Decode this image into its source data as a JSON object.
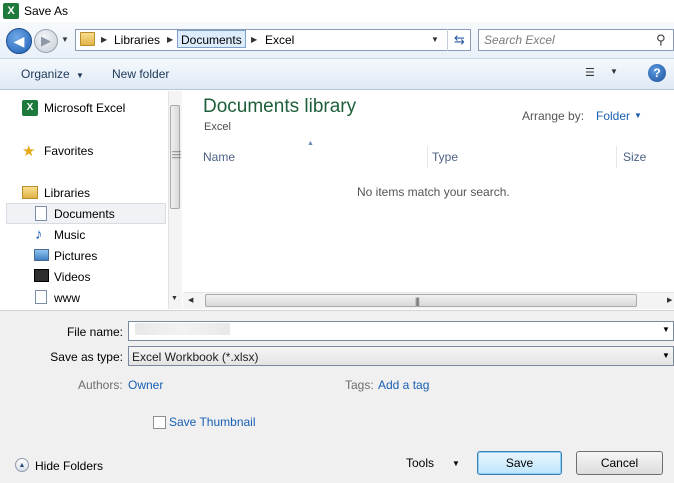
{
  "window": {
    "title": "Save As",
    "app_icon": "excel-icon"
  },
  "address": {
    "breadcrumbs": [
      "Libraries",
      "Documents",
      "Excel"
    ],
    "search_placeholder": "Search Excel"
  },
  "toolbar": {
    "organize_label": "Organize",
    "new_folder_label": "New folder"
  },
  "nav_pane": {
    "items": [
      {
        "label": "Microsoft Excel",
        "icon": "excel-icon"
      },
      {
        "label": "Favorites",
        "icon": "star-icon"
      },
      {
        "label": "Libraries",
        "icon": "library-icon"
      },
      {
        "label": "Documents",
        "icon": "documents-icon",
        "selected": true
      },
      {
        "label": "Music",
        "icon": "music-icon"
      },
      {
        "label": "Pictures",
        "icon": "pictures-icon"
      },
      {
        "label": "Videos",
        "icon": "videos-icon"
      },
      {
        "label": "www",
        "icon": "document-icon"
      }
    ]
  },
  "main": {
    "library_title": "Documents library",
    "library_subtitle": "Excel",
    "arrange_label": "Arrange by:",
    "arrange_value": "Folder",
    "columns": [
      "Name",
      "Type",
      "Size"
    ],
    "empty_message": "No items match your search."
  },
  "details": {
    "file_name_label": "File name:",
    "file_name_value": "",
    "save_type_label": "Save as type:",
    "save_type_value": "Excel Workbook (*.xlsx)",
    "authors_label": "Authors:",
    "authors_value": "Owner",
    "tags_label": "Tags:",
    "tags_value": "Add a tag",
    "thumbnail_label": "Save Thumbnail"
  },
  "footer": {
    "hide_folders_label": "Hide Folders",
    "tools_label": "Tools",
    "save_label": "Save",
    "cancel_label": "Cancel"
  },
  "colors": {
    "library_title": "#1e5f3a",
    "link": "#1a5fb4",
    "command_bar": "#dfe9f5"
  }
}
